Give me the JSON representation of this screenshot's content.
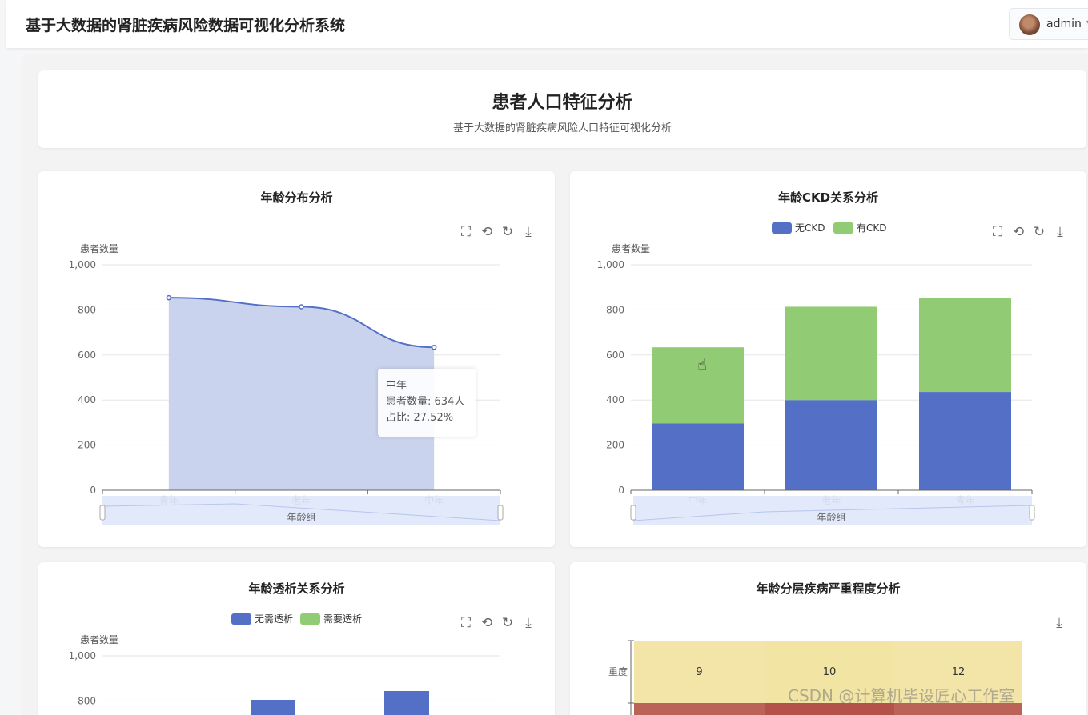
{
  "app": {
    "title": "基于大数据的肾脏疾病风险数据可视化分析系统",
    "user": "admin"
  },
  "header": {
    "title": "患者人口特征分析",
    "subtitle": "基于大数据的肾脏疾病风险人口特征可视化分析"
  },
  "colors": {
    "blue": "#5470c6",
    "green": "#91cc75",
    "area": "#c7d1ec"
  },
  "charts": {
    "age": {
      "title": "年龄分布分析",
      "tooltip": {
        "name": "中年",
        "count_line": "患者数量: 634人",
        "ratio_line": "占比: 27.52%"
      }
    },
    "ckd": {
      "title": "年龄CKD关系分析"
    },
    "dialysis": {
      "title": "年龄透析关系分析"
    },
    "severity": {
      "title": "年龄分层疾病严重程度分析"
    }
  },
  "chart_data": [
    {
      "type": "area",
      "title": "年龄分布分析",
      "ylabel": "患者数量",
      "xlabel": "年龄组",
      "ylim": [
        0,
        1000
      ],
      "yticks": [
        "0",
        "200",
        "400",
        "600",
        "800",
        "1,000"
      ],
      "categories": [
        "青年",
        "老年",
        "中年"
      ],
      "values": [
        854,
        814,
        634
      ]
    },
    {
      "type": "bar",
      "stacked": true,
      "title": "年龄CKD关系分析",
      "ylabel": "患者数量",
      "xlabel": "年龄组",
      "ylim": [
        0,
        1000
      ],
      "yticks": [
        "0",
        "200",
        "400",
        "600",
        "800",
        "1,000"
      ],
      "categories": [
        "中年",
        "老年",
        "青年"
      ],
      "legend_position": "top",
      "series": [
        {
          "name": "无CKD",
          "color": "#5470c6",
          "values": [
            297,
            400,
            436
          ]
        },
        {
          "name": "有CKD",
          "color": "#91cc75",
          "values": [
            337,
            414,
            418
          ]
        }
      ]
    },
    {
      "type": "bar",
      "stacked": true,
      "title": "年龄透析关系分析",
      "ylabel": "患者数量",
      "ylim": [
        0,
        1000
      ],
      "yticks": [
        "800",
        "1,000"
      ],
      "legend_position": "top",
      "series": [
        {
          "name": "无需透析",
          "color": "#5470c6",
          "values": [
            805,
            844
          ]
        },
        {
          "name": "需要透析",
          "color": "#91cc75",
          "values": []
        }
      ]
    },
    {
      "type": "heatmap",
      "title": "年龄分层疾病严重程度分析",
      "rows": [
        "重度"
      ],
      "values": [
        [
          9,
          10,
          12
        ]
      ]
    }
  ],
  "watermark": "CSDN @计算机毕设匠心工作室"
}
